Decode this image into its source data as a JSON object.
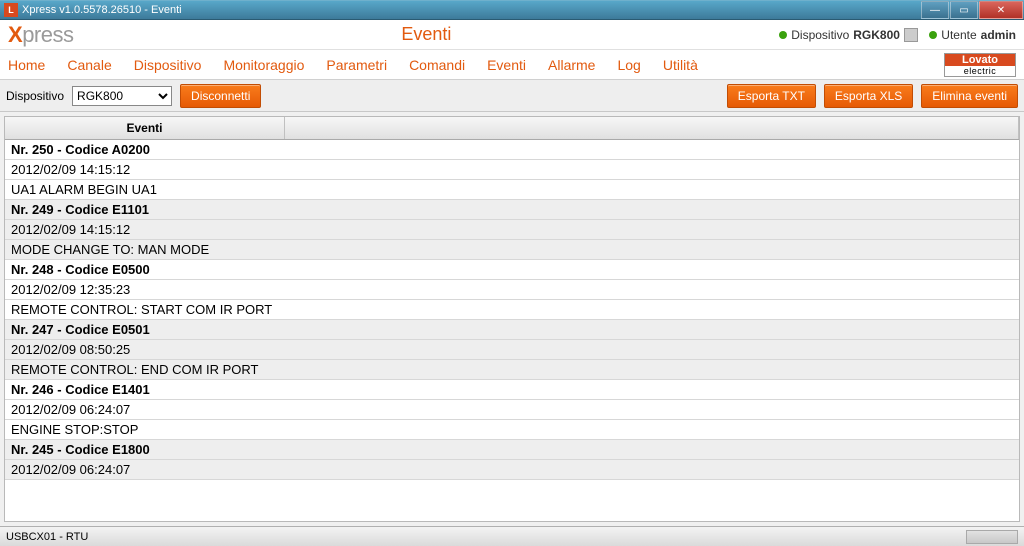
{
  "window": {
    "title": "Xpress v1.0.5578.26510 - Eventi"
  },
  "header": {
    "logo_prefix": "X",
    "logo_rest": "press",
    "page_title": "Eventi",
    "device_label": "Dispositivo",
    "device_name": "RGK800",
    "user_label": "Utente",
    "user_name": "admin"
  },
  "brand": {
    "top": "Lovato",
    "bottom": "electric"
  },
  "menu": [
    "Home",
    "Canale",
    "Dispositivo",
    "Monitoraggio",
    "Parametri",
    "Comandi",
    "Eventi",
    "Allarme",
    "Log",
    "Utilità"
  ],
  "toolbar": {
    "device_label": "Dispositivo",
    "device_selected": "RGK800",
    "disconnect": "Disconnetti",
    "export_txt": "Esporta TXT",
    "export_xls": "Esporta XLS",
    "delete_events": "Elimina eventi"
  },
  "grid": {
    "column_header": "Eventi",
    "events": [
      {
        "title": "Nr. 250 - Codice A0200",
        "time": "2012/02/09 14:15:12",
        "desc": "UA1 ALARM BEGIN UA1"
      },
      {
        "title": "Nr. 249 - Codice E1101",
        "time": "2012/02/09 14:15:12",
        "desc": "MODE CHANGE TO: MAN MODE"
      },
      {
        "title": "Nr. 248 - Codice E0500",
        "time": "2012/02/09 12:35:23",
        "desc": "REMOTE CONTROL: START COM IR PORT"
      },
      {
        "title": "Nr. 247 - Codice E0501",
        "time": "2012/02/09 08:50:25",
        "desc": "REMOTE CONTROL: END COM IR PORT"
      },
      {
        "title": "Nr. 246 - Codice E1401",
        "time": "2012/02/09 06:24:07",
        "desc": "ENGINE STOP:STOP"
      },
      {
        "title": "Nr. 245 - Codice E1800",
        "time": "2012/02/09 06:24:07",
        "desc": ""
      }
    ]
  },
  "statusbar": {
    "connection": "USBCX01 - RTU"
  }
}
